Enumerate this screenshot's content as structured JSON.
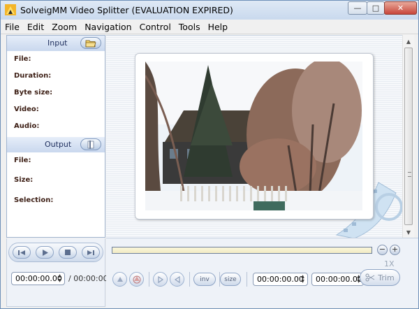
{
  "window": {
    "title": "SolveigMM Video Splitter  (EVALUATION EXPIRED)",
    "minimize_label": "—",
    "maximize_label": "□",
    "close_label": "✕"
  },
  "menu": [
    "File",
    "Edit",
    "Zoom",
    "Navigation",
    "Control",
    "Tools",
    "Help"
  ],
  "input_section": {
    "title": "Input",
    "button_icon": "open-folder-icon",
    "fields": [
      "File:",
      "Duration:",
      "Byte size:",
      "Video:",
      "Audio:"
    ]
  },
  "output_section": {
    "title": "Output",
    "button_icon": "output-folder-icon",
    "fields": [
      "File:",
      "Size:",
      "Selection:"
    ]
  },
  "playback": {
    "buttons": [
      "previous-frame-icon",
      "play-icon",
      "stop-icon",
      "next-frame-icon"
    ],
    "position": "00:00:00.00",
    "duration": "/ 00:00:00"
  },
  "timeline": {
    "zoom_out_label": "−",
    "zoom_in_label": "+",
    "zoom_level": "1X"
  },
  "tools": {
    "invert_label": "inv",
    "size_label": "size",
    "start_time": "00:00:00.00",
    "end_time": "00:00:00.00",
    "trim_label": "Trim"
  },
  "colors": {
    "title_bar": "#c9d9ee",
    "panel_header": "#c9d8ee",
    "timeline_fill": "#f1ebc4",
    "field_label": "#3c1e14"
  }
}
